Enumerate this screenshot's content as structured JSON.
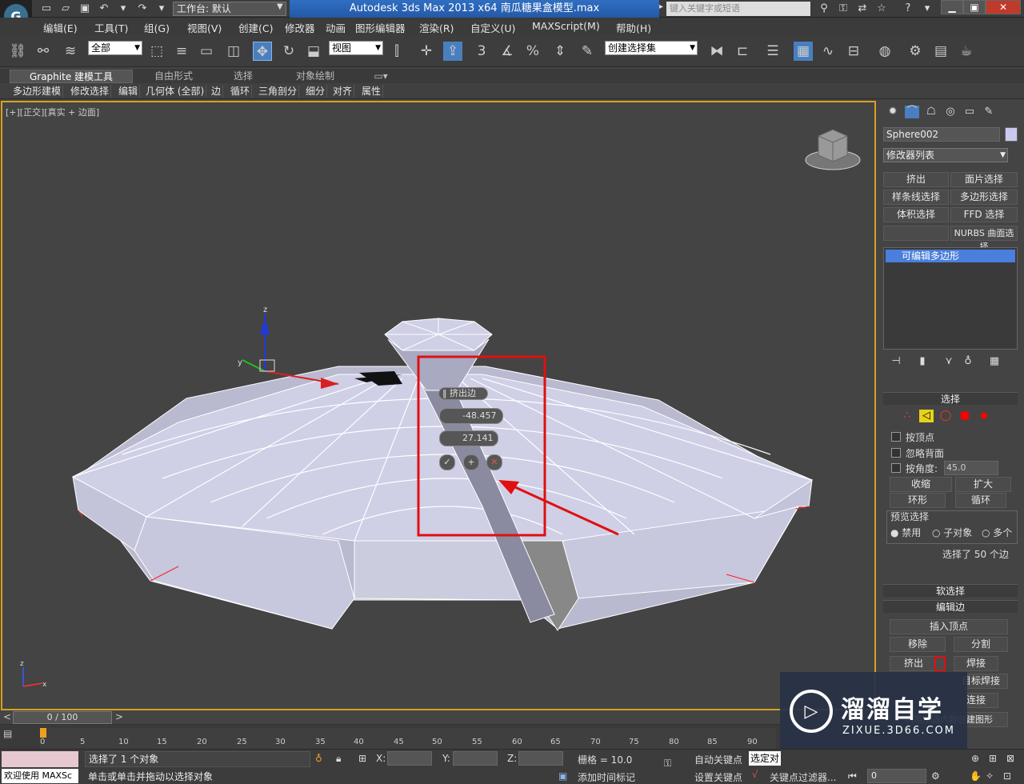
{
  "title": {
    "workspace": "工作台: 默认",
    "app": "Autodesk 3ds Max  2013 x64      南瓜糖果盒模型.max",
    "search_placeholder": "键入关键字或短语"
  },
  "menu": [
    "编辑(E)",
    "工具(T)",
    "组(G)",
    "视图(V)",
    "创建(C)",
    "修改器",
    "动画",
    "图形编辑器",
    "渲染(R)",
    "自定义(U)",
    "MAXScript(M)",
    "帮助(H)"
  ],
  "toolbar": {
    "selection_filter": "全部",
    "ref_coord": "视图",
    "named_selection": "创建选择集",
    "snap_3": "3"
  },
  "ribbon": {
    "tabs": [
      "Graphite 建模工具",
      "自由形式",
      "选择",
      "对象绘制"
    ],
    "sub": [
      "多边形建模",
      "修改选择",
      "编辑",
      "几何体 (全部)",
      "边",
      "循环",
      "三角剖分",
      "细分",
      "对齐",
      "属性"
    ]
  },
  "viewport": {
    "label": "[+][正交][真实 + 边面]",
    "axis_z": "z",
    "axis_y": "y",
    "axis_x": "x",
    "caddy_title": "挤出边",
    "height_value": "-48.457",
    "width_value": "27.141"
  },
  "panel": {
    "object_name": "Sphere002",
    "modifier_list": "修改器列表",
    "mod_buttons": [
      "挤出",
      "面片选择",
      "样条线选择",
      "多边形选择",
      "体积选择",
      "FFD 选择",
      "",
      "NURBS 曲面选择"
    ],
    "stack_item": "可编辑多边形",
    "rollout_select": "选择",
    "by_vertex": "按顶点",
    "ignore_backface": "忽略背面",
    "by_angle": "按角度:",
    "angle_value": "45.0",
    "shrink": "收缩",
    "grow": "扩大",
    "ring": "环形",
    "loop": "循环",
    "preview_label": "预览选择",
    "preview_opts": [
      "禁用",
      "子对象",
      "多个"
    ],
    "selected_info": "选择了 50 个边",
    "soft_select": "软选择",
    "edit_edges": "编辑边",
    "insert_vertex": "插入顶点",
    "remove": "移除",
    "split": "分割",
    "extrude": "挤出",
    "weld": "焊接",
    "target_weld": "目标焊接",
    "connect": "连接",
    "create_shape": "利用所选内容创建图形"
  },
  "timeline": {
    "frame": "0 / 100",
    "ticks": [
      "0",
      "5",
      "10",
      "15",
      "20",
      "25",
      "30",
      "35",
      "40",
      "45",
      "50",
      "55",
      "60",
      "65",
      "70",
      "75",
      "80",
      "85",
      "90"
    ]
  },
  "status": {
    "welcome": "欢迎使用 MAXSc",
    "selected": "选择了 1 个对象",
    "hint": "单击或单击并拖动以选择对象",
    "x_label": "X:",
    "y_label": "Y:",
    "z_label": "Z:",
    "grid": "栅格 = 10.0",
    "auto_key": "自动关键点",
    "selected_obj": "选定对",
    "set_key": "设置关键点",
    "key_filter": "关键点过滤器...",
    "add_time_tag": "添加时间标记",
    "frame_value": "0"
  },
  "watermark": {
    "brand": "溜溜自学",
    "url": "ZIXUE.3D66.COM"
  }
}
